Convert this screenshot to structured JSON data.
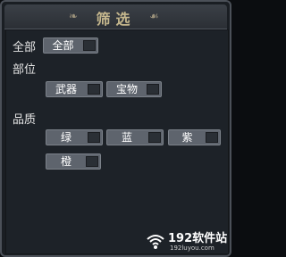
{
  "title": "筛选",
  "sections": {
    "all": {
      "label": "全部",
      "toggle_label": "全部"
    },
    "slot": {
      "label": "部位",
      "options": [
        "武器",
        "宝物"
      ]
    },
    "quality": {
      "label": "品质",
      "options": [
        "绿",
        "蓝",
        "紫",
        "橙"
      ]
    }
  },
  "watermark": {
    "name": "192软件站",
    "url": "192luyou.com"
  },
  "colors": {
    "title": "#c5b78d",
    "toggle_bg": "#5e646d",
    "panel_bg": "#1d2228"
  },
  "icons": [
    "ornament-left-icon",
    "ornament-right-icon",
    "checkbox-icon",
    "wifi-icon"
  ]
}
